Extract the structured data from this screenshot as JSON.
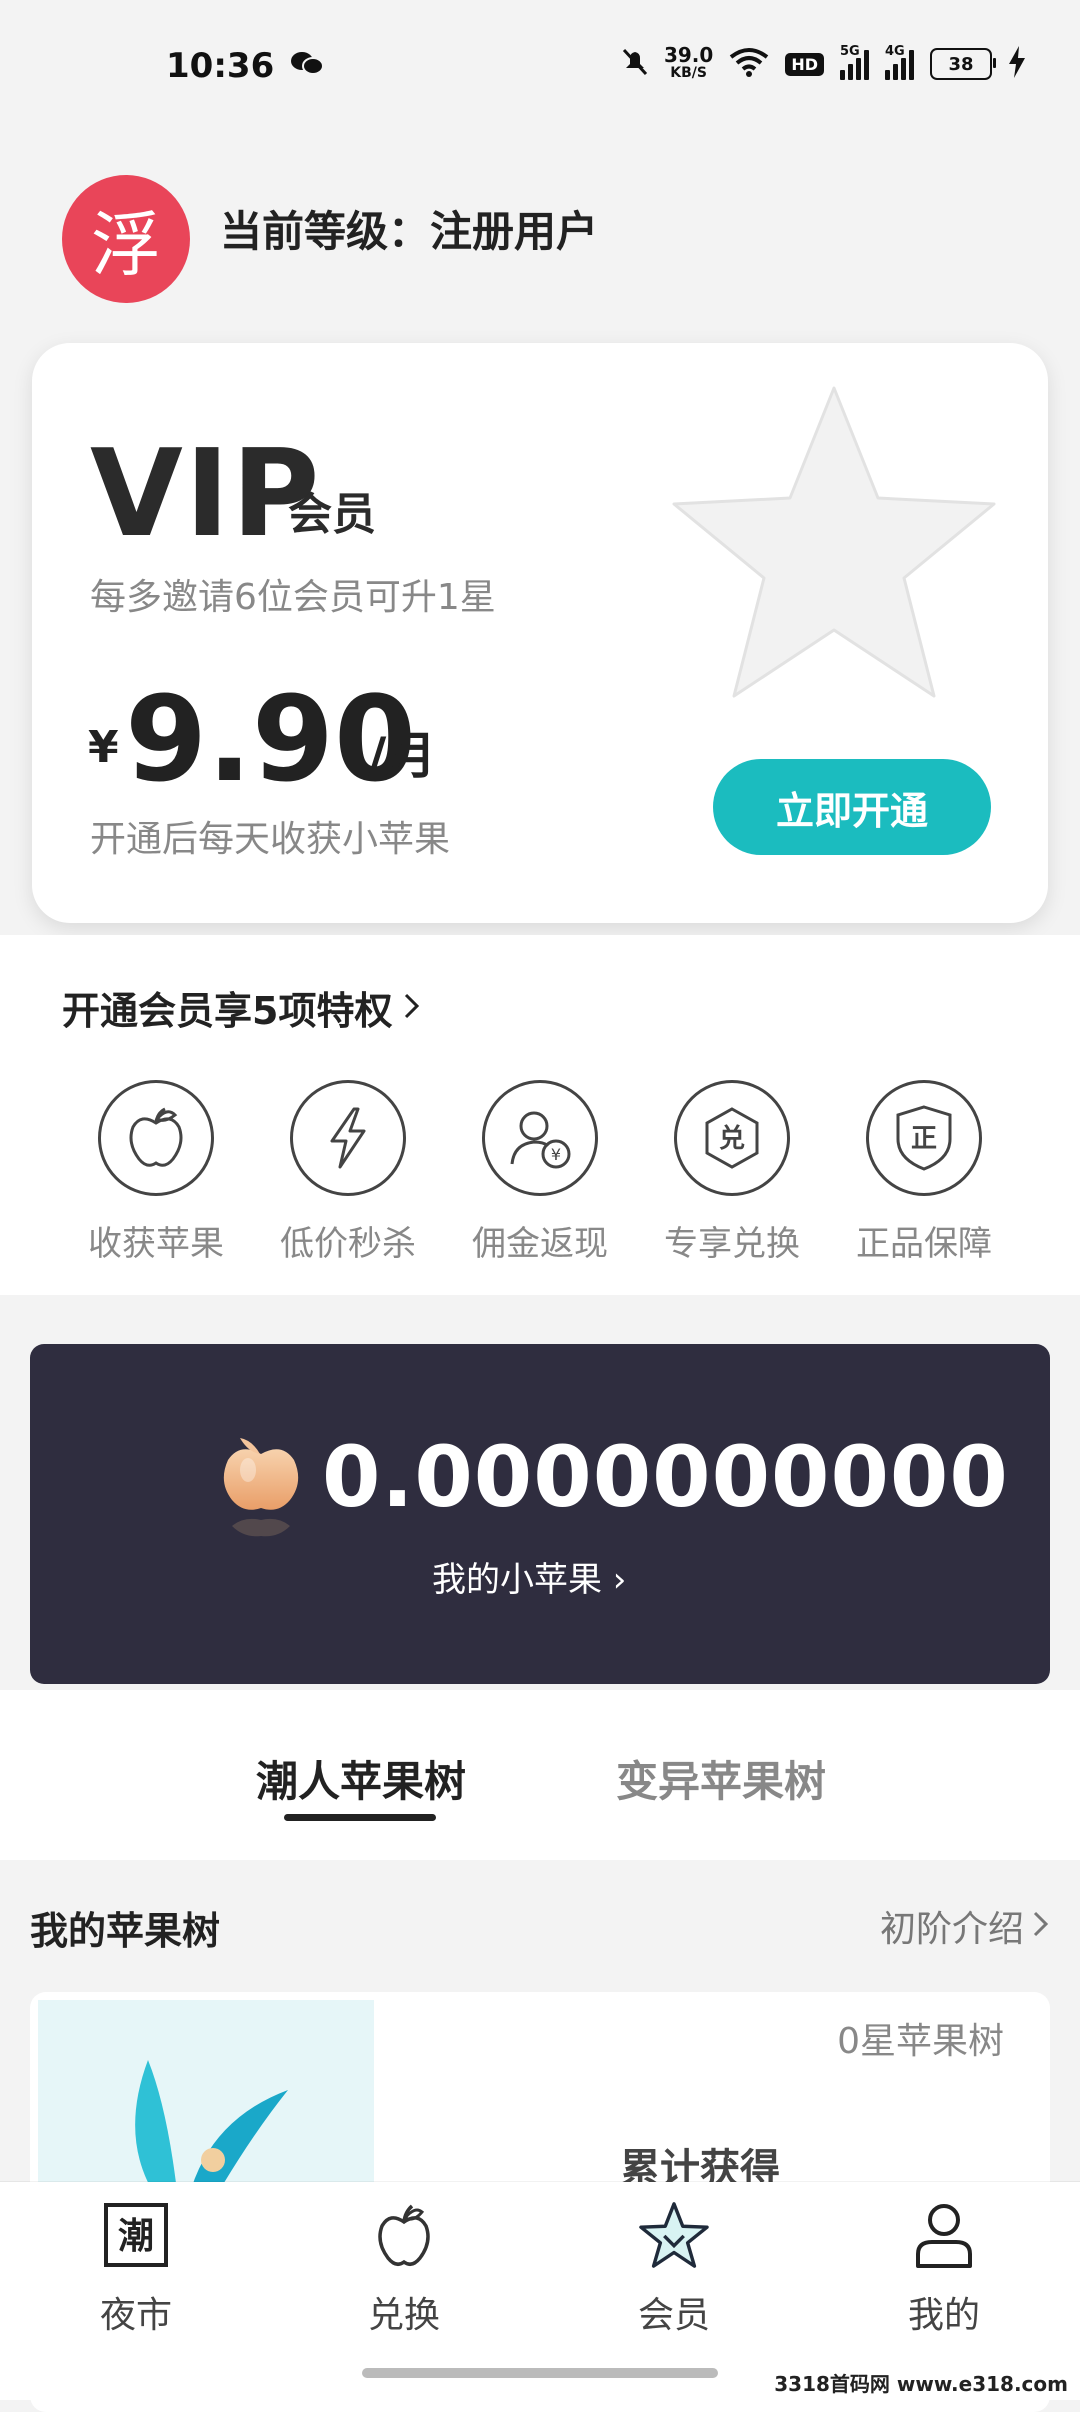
{
  "status_bar": {
    "time": "10:36",
    "net_speed_value": "39.0",
    "net_speed_unit": "KB/S",
    "hd_badge": "HD",
    "sig1_label": "5G",
    "sig2_label": "4G",
    "battery": "38"
  },
  "header": {
    "logo_char": "浮",
    "level_text": "当前等级：注册用户"
  },
  "vip_card": {
    "title": "VIP",
    "title_suffix": "会员",
    "invite_desc": "每多邀请6位会员可升1星",
    "currency": "¥",
    "price": "9.90",
    "unit": "/月",
    "note": "开通后每天收获小苹果",
    "open_button": "立即开通"
  },
  "privileges": {
    "title": "开通会员享5项特权",
    "items": [
      {
        "label": "收获苹果",
        "icon": "apple-icon"
      },
      {
        "label": "低价秒杀",
        "icon": "lightning-icon"
      },
      {
        "label": "佣金返现",
        "icon": "user-cash-icon"
      },
      {
        "label": "专享兑换",
        "icon": "exchange-hex-icon"
      },
      {
        "label": "正品保障",
        "icon": "genuine-shield-icon"
      }
    ],
    "exchange_glyph": "兑",
    "genuine_glyph": "正",
    "cash_glyph": "¥"
  },
  "balance": {
    "value": "0.0000000000",
    "link": "我的小苹果 ›"
  },
  "tabs": {
    "tab1": "潮人苹果树",
    "tab2": "变异苹果树"
  },
  "tree": {
    "title": "我的苹果树",
    "intro": "初阶介绍",
    "star_level": "0星苹果树",
    "gain_label": "累计获得"
  },
  "bottom_nav": {
    "items": [
      {
        "label": "夜市",
        "icon": "night-market-icon",
        "glyph": "潮"
      },
      {
        "label": "兑换",
        "icon": "apple-outline-icon"
      },
      {
        "label": "会员",
        "icon": "star-icon"
      },
      {
        "label": "我的",
        "icon": "profile-icon"
      }
    ]
  },
  "watermark": "3318首码网 www.e318.com",
  "colors": {
    "accent": "#1bbcbf",
    "logo_bg": "#e94559",
    "balance_bg": "#2f2d3f"
  }
}
